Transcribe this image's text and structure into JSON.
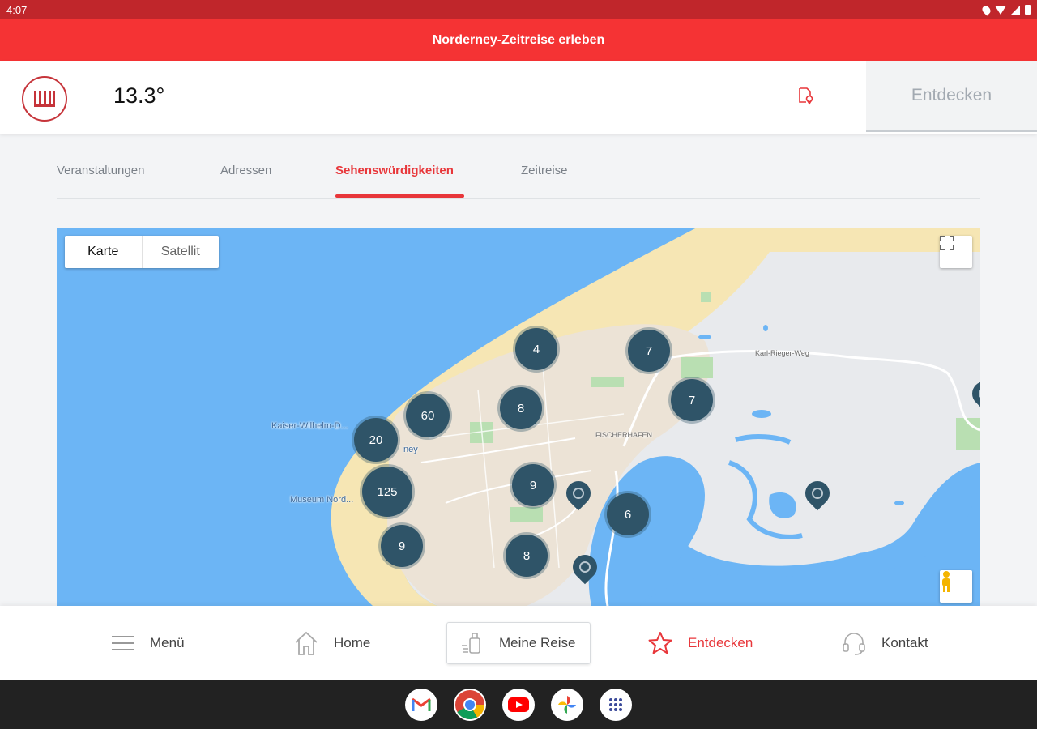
{
  "status_bar": {
    "time": "4:07"
  },
  "banner": {
    "title": "Norderney-Zeitreise erleben"
  },
  "header": {
    "temperature": "13.3°",
    "right_tab_label": "Entdecken",
    "logo_icon": "norderney-logo-icon",
    "doc_icon": "document-location-icon"
  },
  "tabs": [
    {
      "label": "Veranstaltungen",
      "active": false
    },
    {
      "label": "Adressen",
      "active": false
    },
    {
      "label": "Sehenswürdigkeiten",
      "active": true
    },
    {
      "label": "Zeitreise",
      "active": false
    }
  ],
  "map": {
    "type_buttons": [
      "Karte",
      "Satellit"
    ],
    "clusters": [
      "4",
      "7",
      "60",
      "8",
      "7",
      "20",
      "125",
      "9",
      "6",
      "9",
      "8"
    ],
    "labels": [
      "Kaiser-Wilhelm-D...",
      "Museum Nord...",
      "ney",
      "FISCHERHAFEN",
      "Karl-Rieger-Weg"
    ]
  },
  "bottom_nav": [
    {
      "label": "Menü",
      "icon": "hamburger-menu-icon"
    },
    {
      "label": "Home",
      "icon": "home-icon"
    },
    {
      "label": "Meine Reise",
      "icon": "luggage-icon"
    },
    {
      "label": "Entdecken",
      "icon": "star-icon"
    },
    {
      "label": "Kontakt",
      "icon": "headset-icon"
    }
  ],
  "taskbar_apps": [
    "gmail-icon",
    "chrome-icon",
    "youtube-icon",
    "photos-icon",
    "app-launcher-icon"
  ],
  "colors": {
    "accent": "#e8363a",
    "banner": "#f53334",
    "status": "#c0262b",
    "marker": "#2f5468",
    "water": "#6cb5f5"
  }
}
